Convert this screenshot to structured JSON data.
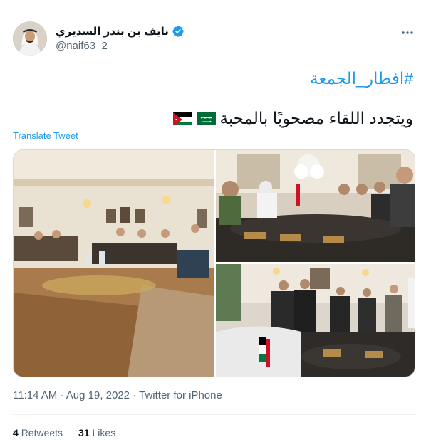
{
  "author": {
    "display_name": "نايف بن بندر السديري",
    "handle": "@naif63_2",
    "verified": true
  },
  "tweet": {
    "hashtag": "#افطار_الجمعة",
    "text": "ويتجدد اللقاء مصحوبًا بالمحبة",
    "flags": [
      "saudi-flag",
      "jordan-flag"
    ],
    "translate_label": "Translate Tweet",
    "time": "11:14 AM",
    "date": "Aug 19, 2022",
    "separator": "·",
    "source": "Twitter for iPhone"
  },
  "stats": {
    "retweets_count": "4",
    "retweets_label": "Retweets",
    "likes_count": "31",
    "likes_label": "Likes"
  },
  "colors": {
    "link": "#1d9bf0",
    "text_primary": "#0f1419",
    "text_secondary": "#536471",
    "border": "#cfd9de"
  }
}
